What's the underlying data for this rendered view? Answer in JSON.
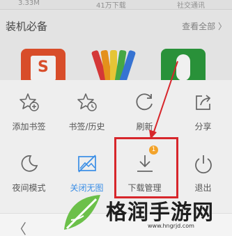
{
  "background_page": {
    "size_label": "3.33M",
    "downloads_label": "41万下载",
    "category_label": "社交通讯",
    "section_title": "装机必备",
    "view_all": "查看全部 〉"
  },
  "menu": {
    "items": [
      {
        "label": "添加书签",
        "icon": "star-plus-icon"
      },
      {
        "label": "书签/历史",
        "icon": "star-clock-icon"
      },
      {
        "label": "刷新",
        "icon": "refresh-icon"
      },
      {
        "label": "分享",
        "icon": "share-icon"
      },
      {
        "label": "夜间模式",
        "icon": "moon-icon"
      },
      {
        "label": "关闭无图",
        "icon": "no-image-icon"
      },
      {
        "label": "下载管理",
        "icon": "download-icon",
        "badge": "1"
      },
      {
        "label": "退出",
        "icon": "power-icon"
      }
    ]
  },
  "bottom_bar": {
    "back": "〈"
  },
  "watermark": {
    "text": "格润手游网",
    "url": "www.hngrjd.com"
  },
  "colors": {
    "accent": "#3a8ee6",
    "badge": "#f3a32a",
    "annotation": "#d7262b"
  }
}
